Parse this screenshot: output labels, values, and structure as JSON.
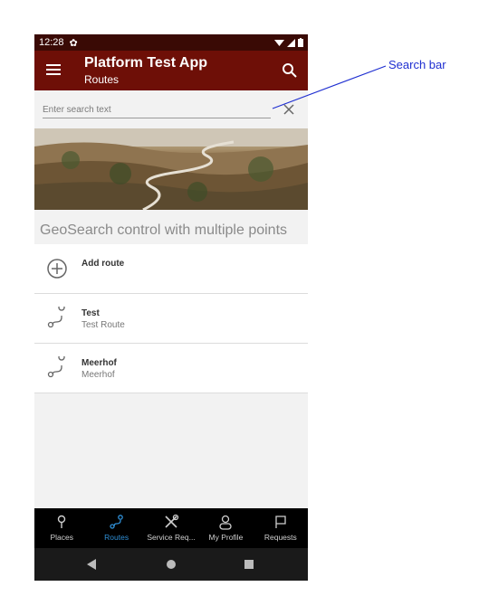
{
  "status_bar": {
    "time": "12:28"
  },
  "app_bar": {
    "title": "Platform Test App",
    "subtitle": "Routes"
  },
  "search": {
    "placeholder": "Enter search text"
  },
  "section_title": "GeoSearch control with multiple points",
  "list": [
    {
      "title": "Add route",
      "subtitle": "",
      "icon": "add-circle-icon"
    },
    {
      "title": "Test",
      "subtitle": "Test Route",
      "icon": "route-icon"
    },
    {
      "title": "Meerhof",
      "subtitle": "Meerhof",
      "icon": "route-icon"
    }
  ],
  "bottom_nav": [
    {
      "label": "Places",
      "icon": "place-pin-icon",
      "active": false
    },
    {
      "label": "Routes",
      "icon": "route-icon",
      "active": true
    },
    {
      "label": "Service Req...",
      "icon": "tools-icon",
      "active": false
    },
    {
      "label": "My Profile",
      "icon": "person-icon",
      "active": false
    },
    {
      "label": "Requests",
      "icon": "flag-icon",
      "active": false
    }
  ],
  "annotation": {
    "label": "Search bar",
    "color": "#1f2fd1"
  },
  "colors": {
    "status_bar": "#3a0a05",
    "app_bar": "#6e0f07",
    "active_nav": "#2f8fd6"
  }
}
